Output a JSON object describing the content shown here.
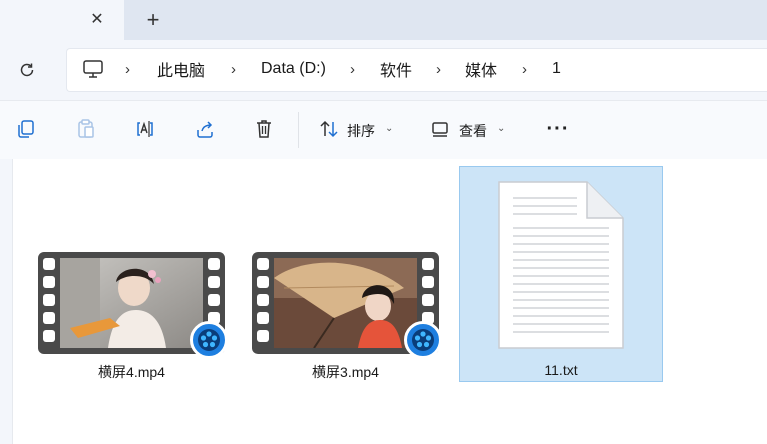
{
  "window": {
    "tab_close_glyph": "✕",
    "new_tab_glyph": "+"
  },
  "address": {
    "breadcrumbs": [
      "此电脑",
      "Data (D:)",
      "软件",
      "媒体",
      "1"
    ],
    "separator": "›"
  },
  "toolbar": {
    "sort_label": "排序",
    "view_label": "查看",
    "more_glyph": "···",
    "chevron": "⌄"
  },
  "files": [
    {
      "name": "横屏4.mp4",
      "type": "video",
      "selected": false
    },
    {
      "name": "横屏3.mp4",
      "type": "video",
      "selected": false
    },
    {
      "name": "11.txt",
      "type": "text",
      "selected": true
    }
  ],
  "colors": {
    "selection_fill": "#cce4f7",
    "selection_border": "#99c9ef",
    "badge_blue": "#1e7fe0"
  }
}
